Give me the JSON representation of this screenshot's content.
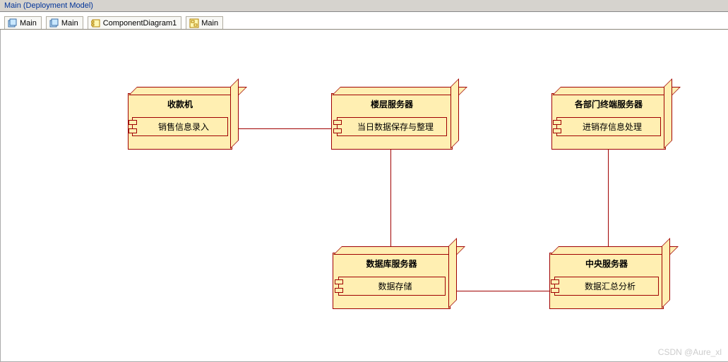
{
  "window": {
    "title": "Main (Deployment Model)"
  },
  "tabs": [
    {
      "label": "Main",
      "icon": "deploy-icon"
    },
    {
      "label": "Main",
      "icon": "deploy-icon"
    },
    {
      "label": "ComponentDiagram1",
      "icon": "component-icon"
    },
    {
      "label": "Main",
      "icon": "diagram-icon"
    }
  ],
  "nodes": {
    "cashier": {
      "title": "收款机",
      "component": "销售信息录入"
    },
    "floor_server": {
      "title": "楼层服务器",
      "component": "当日数据保存与整理"
    },
    "dept_server": {
      "title": "各部门终端服务器",
      "component": "进销存信息处理"
    },
    "db_server": {
      "title": "数据库服务器",
      "component": "数据存储"
    },
    "central_server": {
      "title": "中央服务器",
      "component": "数据汇总分析"
    }
  },
  "links": [
    [
      "cashier",
      "floor_server"
    ],
    [
      "floor_server",
      "db_server"
    ],
    [
      "db_server",
      "central_server"
    ],
    [
      "central_server",
      "dept_server"
    ]
  ],
  "watermark": "CSDN @Aure_xl"
}
